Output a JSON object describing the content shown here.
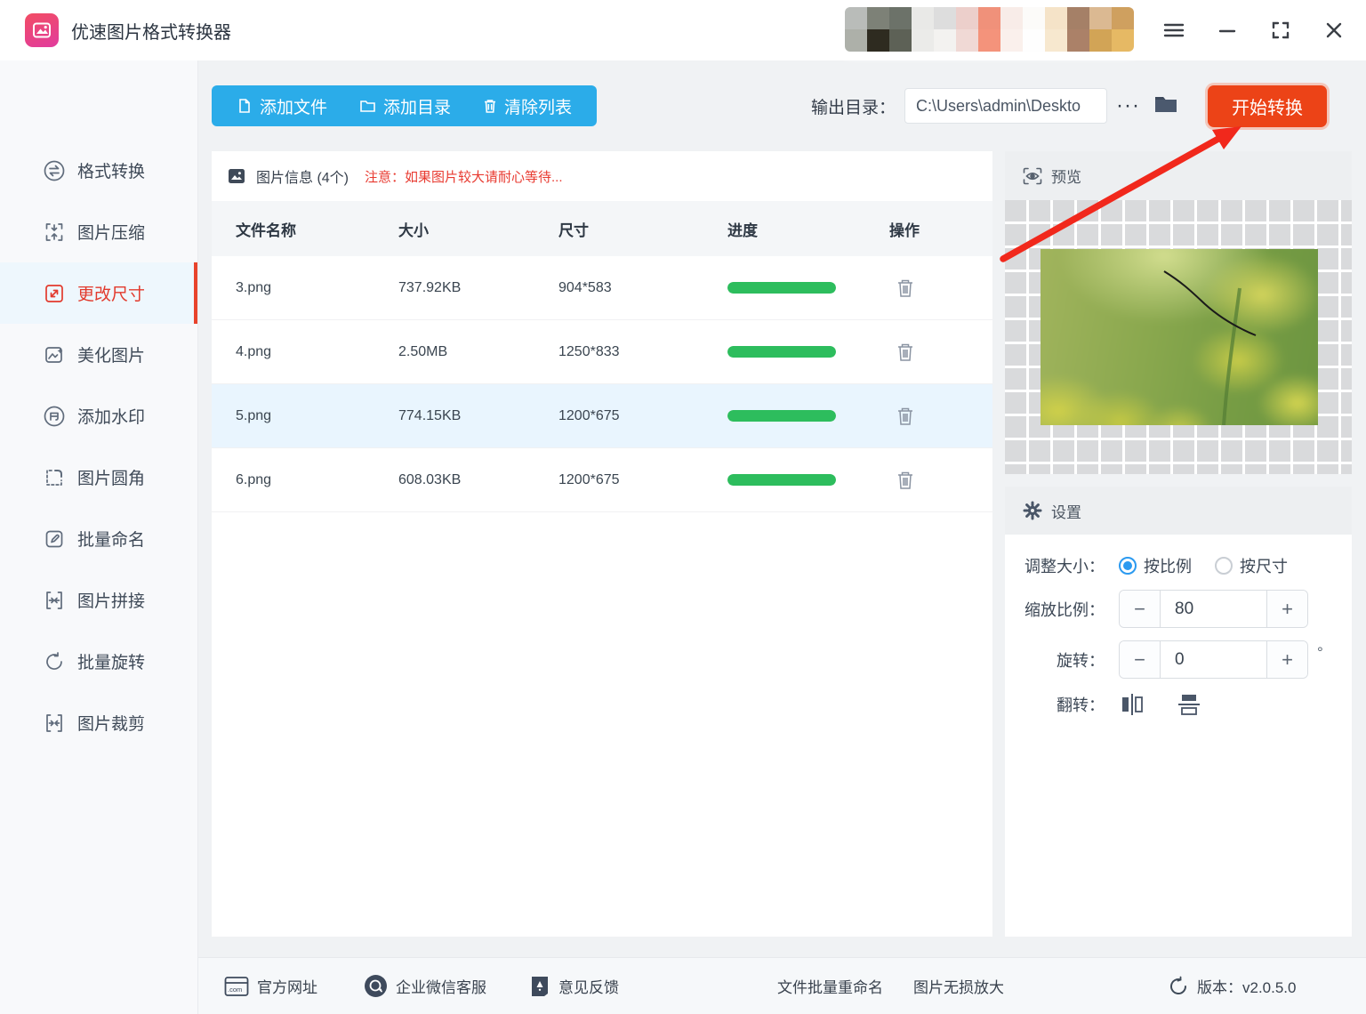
{
  "titlebar": {
    "app_title": "优速图片格式转换器"
  },
  "toolbar": {
    "add_file": "添加文件",
    "add_dir": "添加目录",
    "clear_list": "清除列表",
    "output_label": "输出目录：",
    "output_path": "C:\\Users\\admin\\Deskto",
    "more": "···",
    "start": "开始转换"
  },
  "sidebar": {
    "items": [
      {
        "label": "格式转换"
      },
      {
        "label": "图片压缩"
      },
      {
        "label": "更改尺寸"
      },
      {
        "label": "美化图片"
      },
      {
        "label": "添加水印"
      },
      {
        "label": "图片圆角"
      },
      {
        "label": "批量命名"
      },
      {
        "label": "图片拼接"
      },
      {
        "label": "批量旋转"
      },
      {
        "label": "图片裁剪"
      }
    ],
    "active_index": 2
  },
  "table": {
    "info_title": "图片信息 (4个)",
    "note": "注意：如果图片较大请耐心等待...",
    "columns": [
      "文件名称",
      "大小",
      "尺寸",
      "进度",
      "操作"
    ],
    "rows": [
      {
        "name": "3.png",
        "size": "737.92KB",
        "dims": "904*583",
        "progress": 100
      },
      {
        "name": "4.png",
        "size": "2.50MB",
        "dims": "1250*833",
        "progress": 100
      },
      {
        "name": "5.png",
        "size": "774.15KB",
        "dims": "1200*675",
        "progress": 100
      },
      {
        "name": "6.png",
        "size": "608.03KB",
        "dims": "1200*675",
        "progress": 100
      }
    ]
  },
  "preview": {
    "title": "预览"
  },
  "settings": {
    "title": "设置",
    "resize_label": "调整大小：",
    "radio_ratio": "按比例",
    "radio_size": "按尺寸",
    "scale_label": "缩放比例：",
    "scale_value": "80",
    "rotate_label": "旋转：",
    "rotate_value": "0",
    "degree": "°",
    "flip_label": "翻转："
  },
  "footer": {
    "site": "官方网址",
    "wechat": "企业微信客服",
    "feedback": "意见反馈",
    "batch_rename": "文件批量重命名",
    "lossless": "图片无损放大",
    "version": "版本：v2.0.5.0"
  },
  "colors": {
    "toolbar_blue": "#2bace9",
    "start_red": "#ec4317",
    "progress_green": "#2dbd5d",
    "active_red": "#e23a2d",
    "row_highlight": "#e9f5fe"
  }
}
